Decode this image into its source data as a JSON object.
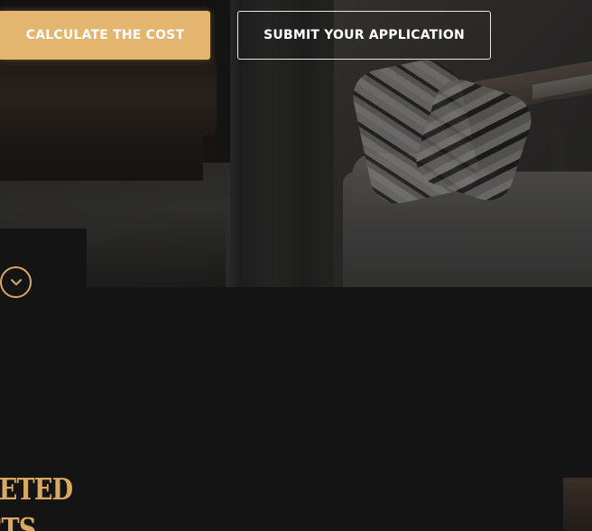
{
  "hero": {
    "background_image": "living-room-photo"
  },
  "actions": {
    "calculate_label": "CALCULATE THE COST",
    "submit_label": "SUBMIT YOUR APPLICATION"
  },
  "scroll": {
    "icon": "chevron-down-icon"
  },
  "section": {
    "title_line1": "PLETED",
    "title_line2": "ECTS"
  },
  "colors": {
    "accent": "#e3b56e",
    "accent_outline": "#d9a962",
    "background": "#141414",
    "text_light": "#ffffff"
  }
}
